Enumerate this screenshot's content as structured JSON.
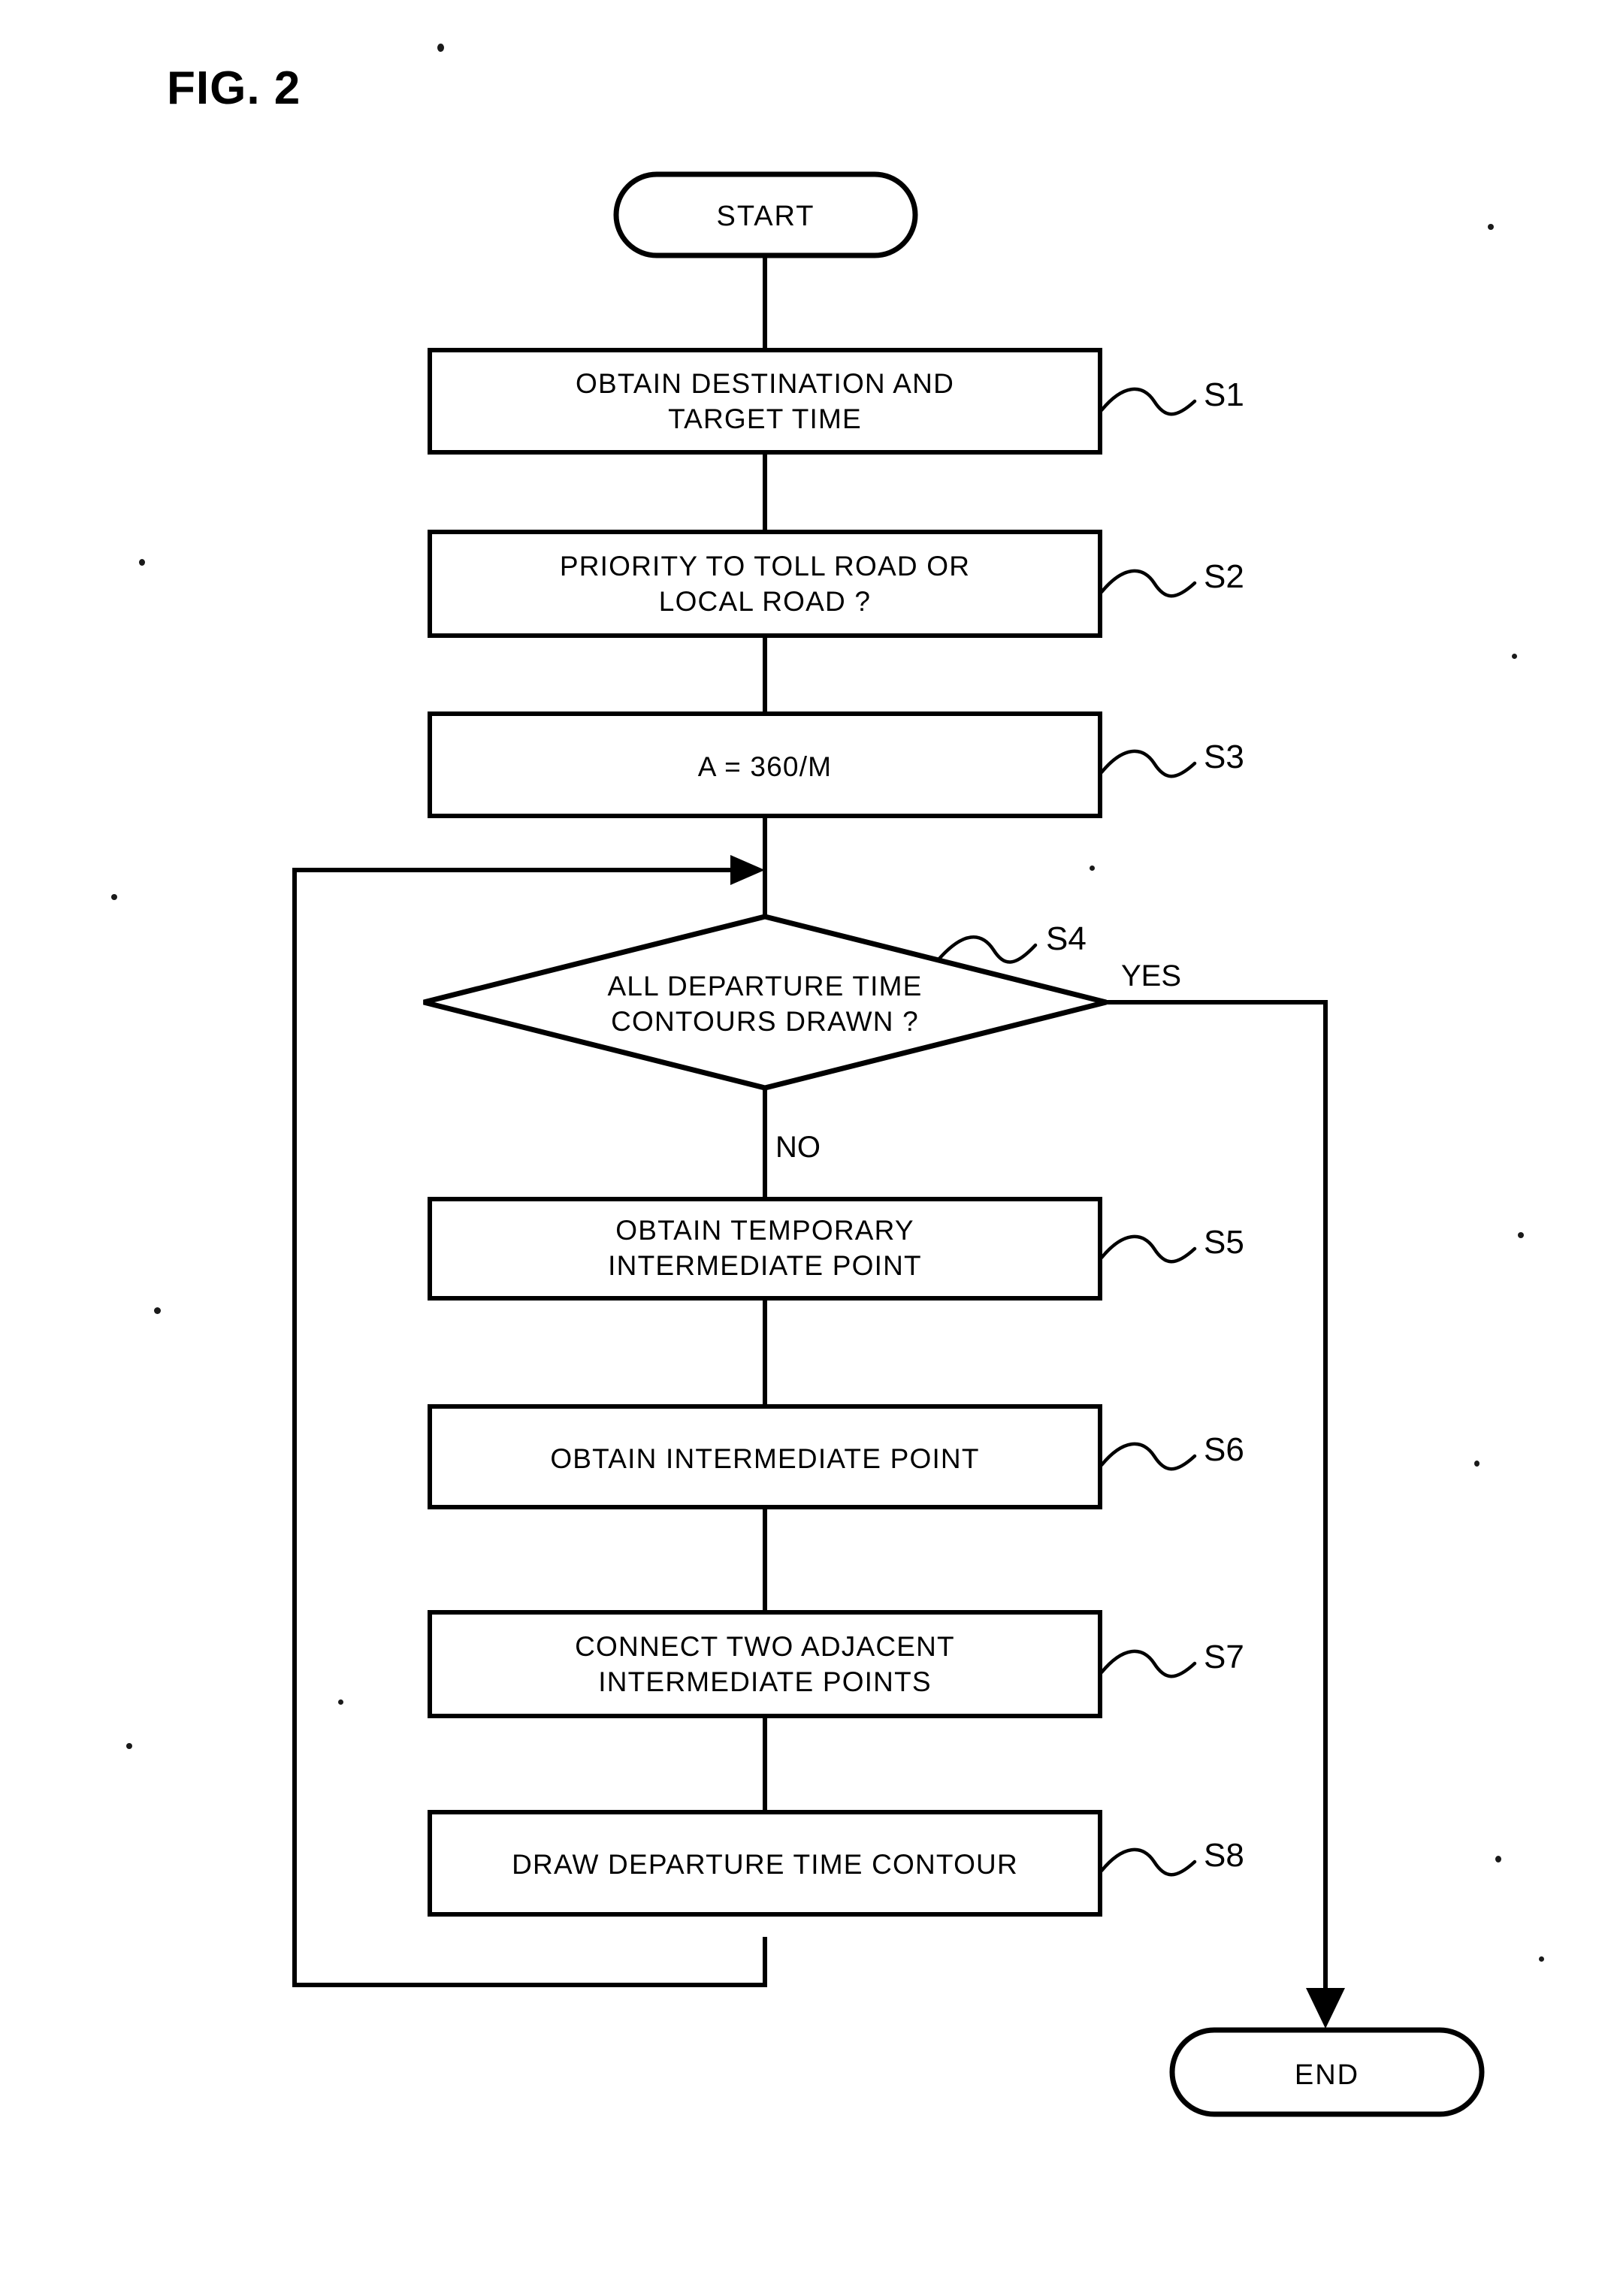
{
  "figure": {
    "title": "FIG. 2"
  },
  "flowchart": {
    "type": "flowchart",
    "orientation": "vertical",
    "nodes": [
      {
        "id": "start",
        "shape": "terminator",
        "label": "START"
      },
      {
        "id": "s1",
        "shape": "process",
        "label_lines": [
          "OBTAIN DESTINATION AND",
          "TARGET TIME"
        ],
        "step": "S1"
      },
      {
        "id": "s2",
        "shape": "process",
        "label_lines": [
          "PRIORITY TO TOLL ROAD OR",
          "LOCAL ROAD ?"
        ],
        "step": "S2"
      },
      {
        "id": "s3",
        "shape": "process",
        "label_lines": [
          "A = 360/M"
        ],
        "step": "S3"
      },
      {
        "id": "s4",
        "shape": "decision",
        "label_lines": [
          "ALL DEPARTURE TIME",
          "CONTOURS DRAWN ?"
        ],
        "step": "S4"
      },
      {
        "id": "s5",
        "shape": "process",
        "label_lines": [
          "OBTAIN TEMPORARY",
          "INTERMEDIATE POINT"
        ],
        "step": "S5"
      },
      {
        "id": "s6",
        "shape": "process",
        "label_lines": [
          "OBTAIN INTERMEDIATE POINT"
        ],
        "step": "S6"
      },
      {
        "id": "s7",
        "shape": "process",
        "label_lines": [
          "CONNECT TWO ADJACENT",
          "INTERMEDIATE POINTS"
        ],
        "step": "S7"
      },
      {
        "id": "s8",
        "shape": "process",
        "label_lines": [
          "DRAW DEPARTURE TIME CONTOUR"
        ],
        "step": "S8"
      },
      {
        "id": "end",
        "shape": "terminator",
        "label": "END"
      }
    ],
    "branches": {
      "yes": "YES",
      "no": "NO"
    },
    "edges": [
      {
        "from": "start",
        "to": "s1"
      },
      {
        "from": "s1",
        "to": "s2"
      },
      {
        "from": "s2",
        "to": "s3"
      },
      {
        "from": "s3",
        "to": "s4"
      },
      {
        "from": "s4",
        "to": "s5",
        "label": "NO"
      },
      {
        "from": "s4",
        "to": "end",
        "label": "YES"
      },
      {
        "from": "s5",
        "to": "s6"
      },
      {
        "from": "s6",
        "to": "s7"
      },
      {
        "from": "s7",
        "to": "s8"
      },
      {
        "from": "s8",
        "to": "s4",
        "note": "feedback loop via left side"
      }
    ],
    "step_labels": [
      "S1",
      "S2",
      "S3",
      "S4",
      "S5",
      "S6",
      "S7",
      "S8"
    ],
    "colors": {
      "stroke": "#000000",
      "fill": "#ffffff",
      "text": "#000000"
    }
  }
}
